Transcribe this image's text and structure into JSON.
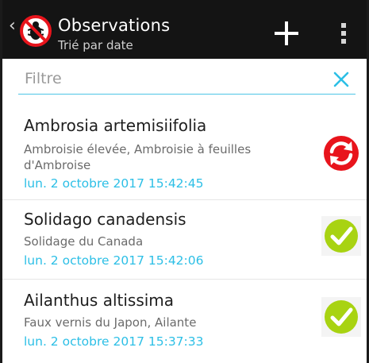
{
  "appbar": {
    "title": "Observations",
    "subtitle": "Trié par date",
    "back_icon": "chevron-left-icon",
    "logo_icon": "no-bug-app-logo",
    "add_icon": "plus-icon",
    "menu_icon": "vertical-dots-icon"
  },
  "filter": {
    "placeholder": "Filtre",
    "value": "",
    "clear_icon": "close-icon",
    "accent_color": "#4dc6e6"
  },
  "observations": [
    {
      "latin_name": "Ambrosia artemisiifolia",
      "common_names_line1": "Ambroisie élevée, Ambroisie à feuilles",
      "common_names_line2": "d'Ambroise",
      "date": "lun. 2 octobre 2017 15:42:45",
      "status": "sync-pending",
      "status_icon": "sync-icon",
      "status_color": "#e8141c"
    },
    {
      "latin_name": "Solidago canadensis",
      "common_names_line1": "Solidage du Canada",
      "common_names_line2": "",
      "date": "lun. 2 octobre 2017 15:42:06",
      "status": "synced",
      "status_icon": "check-circle-icon",
      "status_color": "#a8d312"
    },
    {
      "latin_name": "Ailanthus altissima",
      "common_names_line1": "Faux vernis du Japon, Ailante",
      "common_names_line2": "",
      "date": "lun. 2 octobre 2017 15:37:33",
      "status": "synced",
      "status_icon": "check-circle-icon",
      "status_color": "#a8d312"
    }
  ],
  "colors": {
    "appbar_bg": "#141414",
    "date_text": "#2cbfe6"
  }
}
